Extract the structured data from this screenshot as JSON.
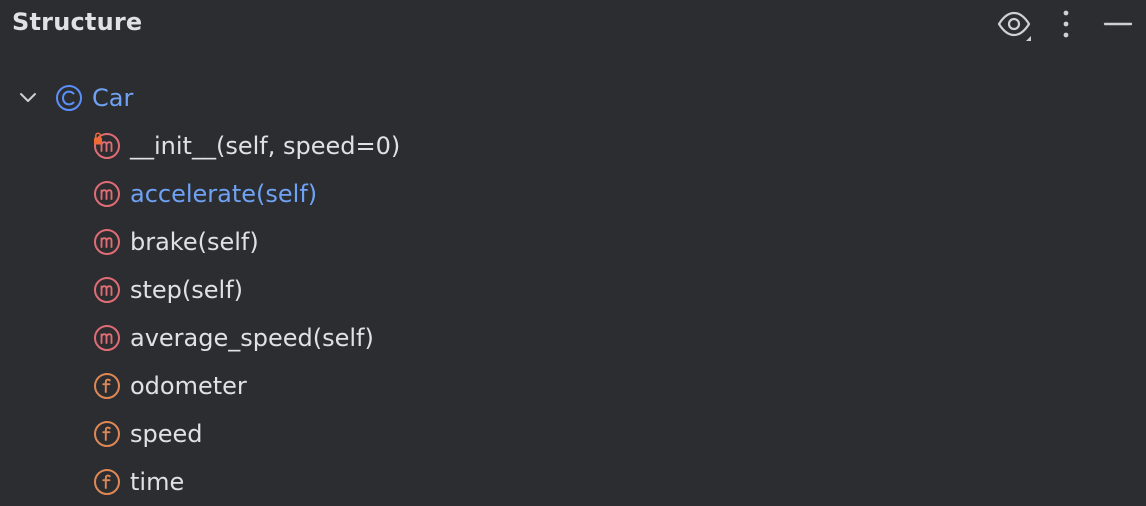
{
  "panel": {
    "title": "Structure"
  },
  "header_actions": [
    {
      "name": "view-options-button",
      "icon": "eye-icon"
    },
    {
      "name": "more-options-button",
      "icon": "more-vertical-icon"
    },
    {
      "name": "hide-panel-button",
      "icon": "minimize-icon"
    }
  ],
  "tree": {
    "root": {
      "label": "Car",
      "kind": "class",
      "icon": "class-icon",
      "expanded": true
    },
    "members": [
      {
        "label": "__init__(self, speed=0)",
        "kind": "method",
        "icon": "method-icon",
        "badge": "lock-icon",
        "selected": false
      },
      {
        "label": "accelerate(self)",
        "kind": "method",
        "icon": "method-icon",
        "selected": true
      },
      {
        "label": "brake(self)",
        "kind": "method",
        "icon": "method-icon",
        "selected": false
      },
      {
        "label": "step(self)",
        "kind": "method",
        "icon": "method-icon",
        "selected": false
      },
      {
        "label": "average_speed(self)",
        "kind": "method",
        "icon": "method-icon",
        "selected": false
      },
      {
        "label": "odometer",
        "kind": "field",
        "icon": "field-icon",
        "selected": false
      },
      {
        "label": "speed",
        "kind": "field",
        "icon": "field-icon",
        "selected": false
      },
      {
        "label": "time",
        "kind": "field",
        "icon": "field-icon",
        "selected": false
      }
    ]
  },
  "colors": {
    "background": "#2b2d30",
    "text": "#dfe1e5",
    "accent_text": "#6fa2f5",
    "class_icon": "#5b8ff9",
    "method_icon": "#e06c75",
    "field_icon": "#e08855",
    "lock_badge": "#ee6a36",
    "header_icon": "#ced0d6"
  }
}
